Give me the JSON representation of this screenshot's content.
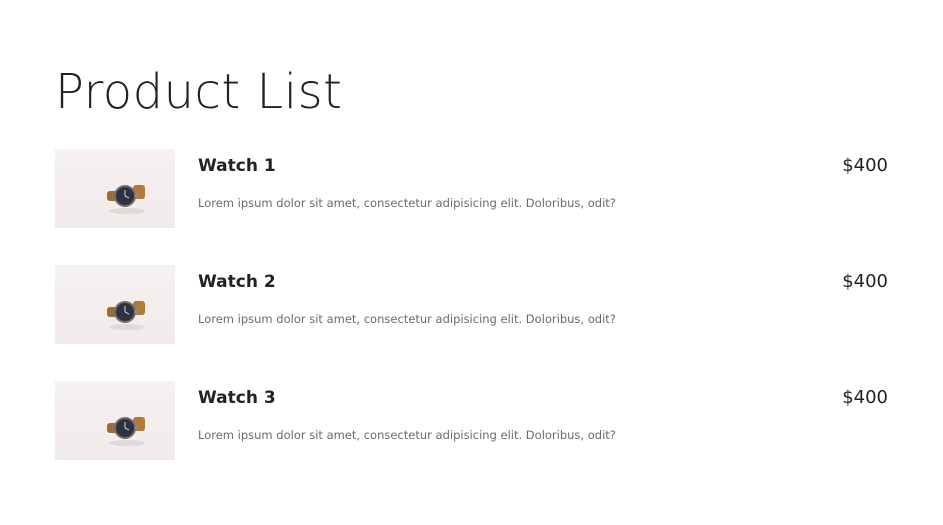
{
  "page": {
    "title": "Product List"
  },
  "products": [
    {
      "name": "Watch 1",
      "description": "Lorem ipsum dolor sit amet, consectetur adipisicing elit. Doloribus, odit?",
      "price": "$400",
      "image_icon": "wristwatch-photo"
    },
    {
      "name": "Watch 2",
      "description": "Lorem ipsum dolor sit amet, consectetur adipisicing elit. Doloribus, odit?",
      "price": "$400",
      "image_icon": "wristwatch-photo"
    },
    {
      "name": "Watch 3",
      "description": "Lorem ipsum dolor sit amet, consectetur adipisicing elit. Doloribus, odit?",
      "price": "$400",
      "image_icon": "wristwatch-photo"
    }
  ],
  "colors": {
    "background": "#ffffff",
    "text": "#222222",
    "muted_text": "#6a6a6a",
    "thumb_background": "#f3eded",
    "watch_strap": "#b07a3c",
    "watch_face": "#2d3140"
  }
}
